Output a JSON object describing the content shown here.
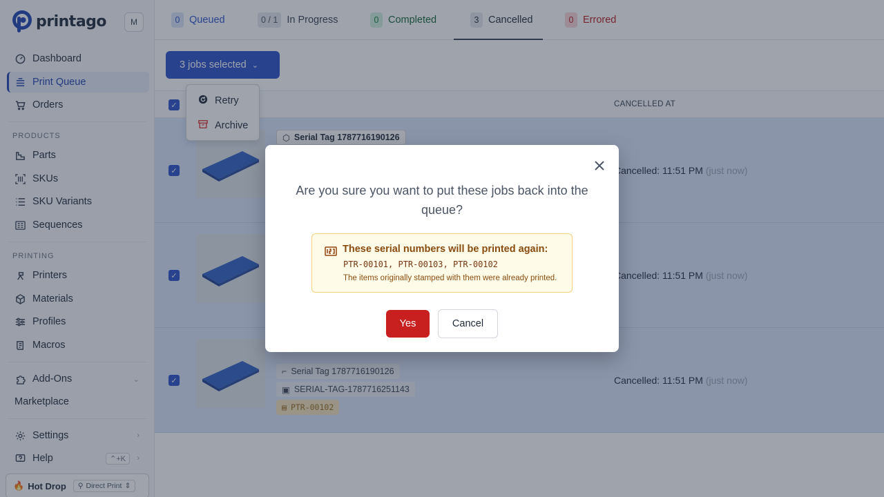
{
  "brand": {
    "name": "printago",
    "workspace_initial": "M",
    "accent": "#2b4fc7"
  },
  "sidebar": {
    "items_top": [
      {
        "label": "Dashboard",
        "icon": "dashboard-icon"
      },
      {
        "label": "Print Queue",
        "icon": "print-queue-icon",
        "active": true
      },
      {
        "label": "Orders",
        "icon": "cart-icon"
      }
    ],
    "products_section": "PRODUCTS",
    "products": [
      {
        "label": "Parts",
        "icon": "parts-icon"
      },
      {
        "label": "SKUs",
        "icon": "barcode-icon"
      },
      {
        "label": "SKU Variants",
        "icon": "list-icon"
      },
      {
        "label": "Sequences",
        "icon": "sequences-icon"
      }
    ],
    "printing_section": "PRINTING",
    "printing": [
      {
        "label": "Printers",
        "icon": "printer-icon"
      },
      {
        "label": "Materials",
        "icon": "cube-icon"
      },
      {
        "label": "Profiles",
        "icon": "sliders-icon"
      },
      {
        "label": "Macros",
        "icon": "scroll-icon"
      }
    ],
    "addons": "Add-Ons",
    "marketplace": "Marketplace",
    "settings": "Settings",
    "help": "Help",
    "help_shortcut": "⌃+K",
    "hotdrop": "Hot Drop",
    "direct_print": "Direct Print"
  },
  "tabs": [
    {
      "count": "0",
      "label": "Queued",
      "color": "#2b4fc7",
      "bg": "#dbe4fa"
    },
    {
      "count": "0 / 1",
      "label": "In Progress",
      "color": "#374151",
      "bg": "#e5e7eb"
    },
    {
      "count": "0",
      "label": "Completed",
      "color": "#15803d",
      "bg": "#d1f0dc"
    },
    {
      "count": "3",
      "label": "Cancelled",
      "color": "#1f2937",
      "bg": "#e5e7eb"
    },
    {
      "count": "0",
      "label": "Errored",
      "color": "#b91c1c",
      "bg": "#fbd5d5"
    }
  ],
  "toolbar": {
    "selection_label": "3 jobs selected"
  },
  "menu": {
    "retry": "Retry",
    "archive": "Archive"
  },
  "table": {
    "col_cancelled_at": "CANCELLED AT",
    "rows": [
      {
        "title": "Serial Tag 1787716190126",
        "part": "",
        "sku": "",
        "serial": "",
        "cancelled": "Cancelled: 11:51 PM",
        "relative": "(just now)"
      },
      {
        "title": "",
        "part": "",
        "sku": "",
        "serial": "",
        "cancelled": "Cancelled: 11:51 PM",
        "relative": "(just now)"
      },
      {
        "title": "",
        "part": "Serial Tag 1787716190126",
        "sku": "SERIAL-TAG-1787716251143",
        "serial": "PTR-00102",
        "cancelled": "Cancelled: 11:51 PM",
        "relative": "(just now)"
      }
    ]
  },
  "modal": {
    "question": "Are you sure you want to put these jobs back into the queue?",
    "warning_title": "These serial numbers will be printed again:",
    "warning_serials": "PTR-00101, PTR-00103, PTR-00102",
    "warning_note": "The items originally stamped with them were already printed.",
    "yes": "Yes",
    "cancel": "Cancel"
  }
}
